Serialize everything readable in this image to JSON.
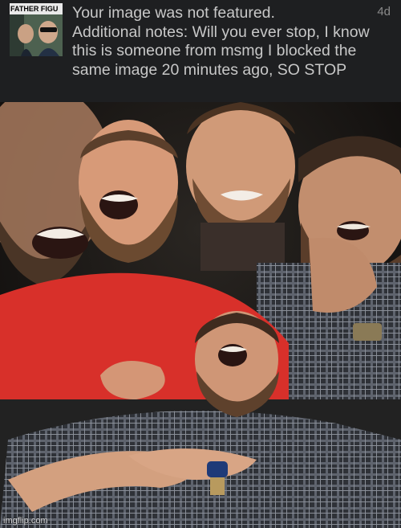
{
  "notification": {
    "thumbnail_label": "FATHER FIGU",
    "message": "Your image was not featured.\nAdditional notes: Will you ever stop, I know this is someone from msmg I blocked the same image 20 minutes ago, SO STOP",
    "age": "4d"
  },
  "meme": {
    "watermark": "imgflip.com"
  },
  "colors": {
    "notification_bg": "#1e1f21",
    "text": "#c8c8c8",
    "muted": "#8a8a8a",
    "shirt_red": "#d8302a",
    "skin": "#d79a78",
    "beard": "#6b4a30"
  }
}
